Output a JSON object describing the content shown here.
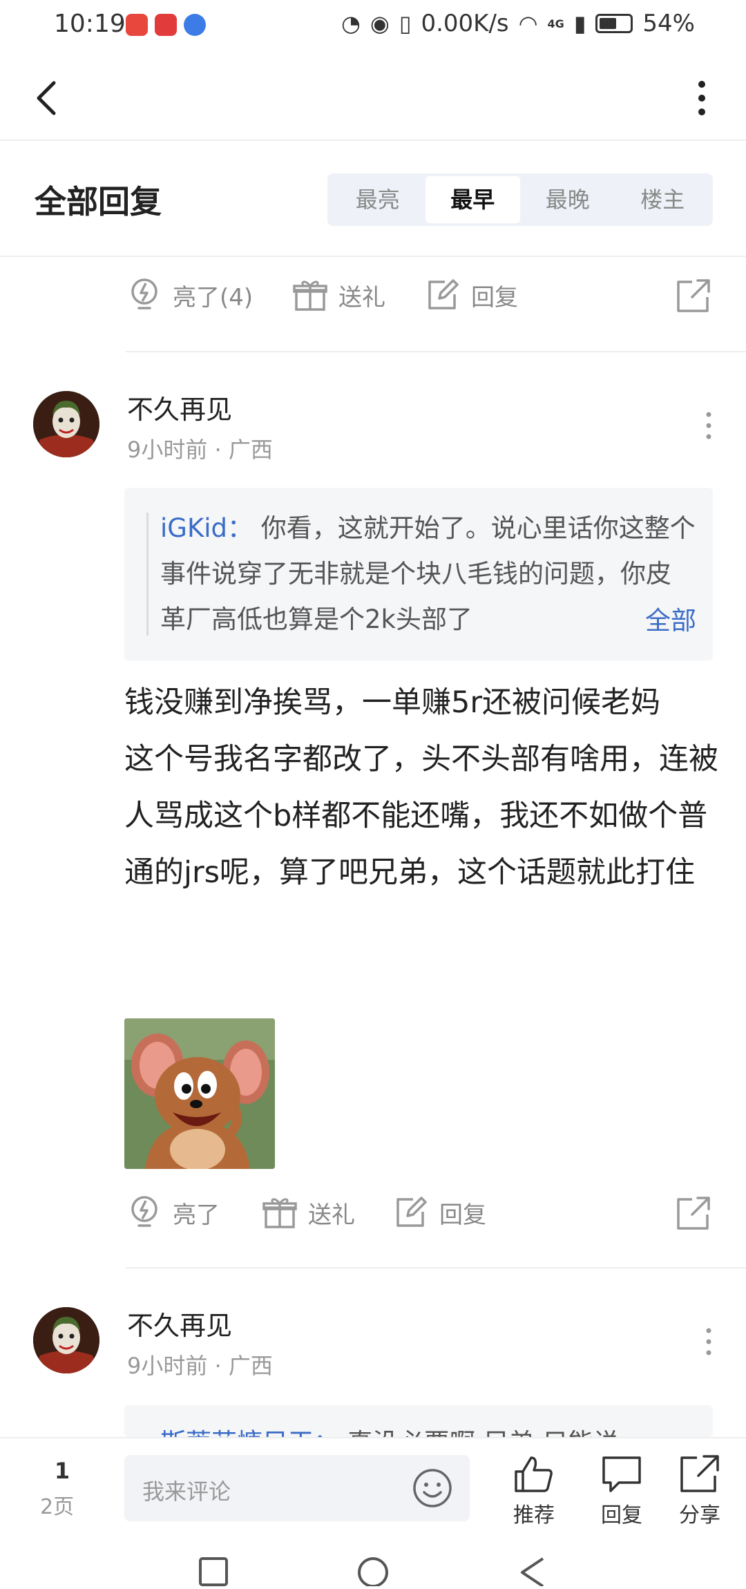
{
  "status_bar": {
    "time": "10:19",
    "network_speed": "0.00K/s",
    "signal_label": "4G",
    "battery": "54%"
  },
  "header": {
    "title": "全部回复",
    "sort_tabs": [
      "最亮",
      "最早",
      "最晚",
      "楼主"
    ],
    "active_sort": "最早"
  },
  "prev_post_actions": {
    "like_label": "亮了(4)",
    "gift_label": "送礼",
    "reply_label": "回复"
  },
  "comments": [
    {
      "username": "不久再见",
      "time": "9小时前",
      "separator": "·",
      "location": "广西",
      "quote": {
        "author": "iGKid：",
        "text": "你看，这就开始了。说心里话你这整个事件说穿了无非就是个块八毛钱的问题，你皮革厂高低也算是个2k头部了",
        "expand_label": "全部"
      },
      "body": [
        "钱没赚到净挨骂，一单赚5r还被问候老妈",
        "这个号我名字都改了，头不头部有啥用，连被人骂成这个b样都不能还嘴，我还不如做个普通的jrs呢，算了吧兄弟，这个话题就此打住"
      ],
      "actions": {
        "like_label": "亮了",
        "gift_label": "送礼",
        "reply_label": "回复"
      }
    },
    {
      "username": "不久再见",
      "time": "9小时前",
      "separator": "·",
      "location": "广西",
      "quote": {
        "author": "斯蒂芬慷目干：",
        "text": "真没必要啊 兄弟 只能说"
      }
    }
  ],
  "bottom_bar": {
    "page_current": "1",
    "page_total": "2页",
    "input_placeholder": "我来评论",
    "recommend_label": "推荐",
    "reply_label": "回复",
    "share_label": "分享"
  },
  "colors": {
    "link_blue": "#3a6cc6",
    "muted_text": "#888888",
    "sort_bg": "#eef2f8"
  }
}
